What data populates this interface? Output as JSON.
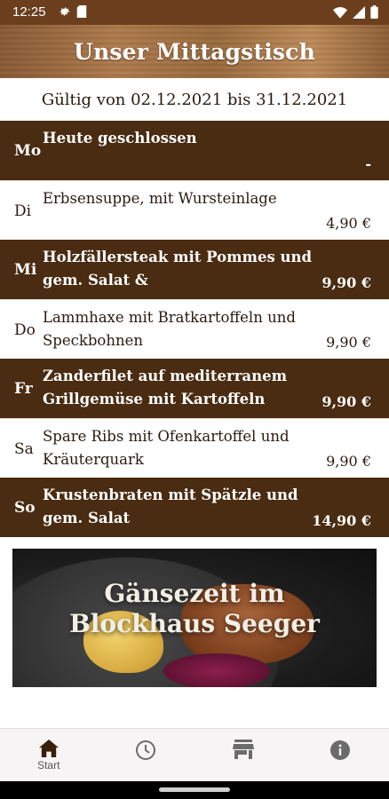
{
  "status_bar": {
    "time": "12:25",
    "icons": [
      "settings-icon",
      "sim-card-icon",
      "wifi-icon",
      "signal-icon",
      "battery-icon"
    ]
  },
  "header": {
    "title": "Unser Mittagstisch"
  },
  "validity": "Gültig von 02.12.2021 bis 31.12.2021",
  "menu": [
    {
      "day": "Mo",
      "dish": "Heute geschlossen",
      "price": "-",
      "style": "dark"
    },
    {
      "day": "Di",
      "dish": "Erbsensuppe, mit Wursteinlage",
      "price": "4,90 €",
      "style": "light"
    },
    {
      "day": "Mi",
      "dish": "Holzfällersteak mit Pommes und gem. Salat &",
      "price": "9,90 €",
      "style": "dark"
    },
    {
      "day": "Do",
      "dish": "Lammhaxe mit Bratkartoffeln und Speckbohnen",
      "price": "9,90 €",
      "style": "light"
    },
    {
      "day": "Fr",
      "dish": "Zanderfilet auf mediterranem Grillgemüse mit Kartoffeln",
      "price": "9,90 €",
      "style": "dark"
    },
    {
      "day": "Sa",
      "dish": "Spare Ribs mit Ofenkartoffel und Kräuterquark",
      "price": "9,90 €",
      "style": "light"
    },
    {
      "day": "So",
      "dish": "Krustenbraten mit Spätzle und gem. Salat",
      "price": "14,90 €",
      "style": "dark"
    }
  ],
  "banner": {
    "line1": "Gänsezeit im",
    "line2": "Blockhaus Seeger"
  },
  "bottom_nav": {
    "items": [
      {
        "icon": "home-icon",
        "label": "Start",
        "active": true
      },
      {
        "icon": "clock-icon",
        "label": "",
        "active": false
      },
      {
        "icon": "store-icon",
        "label": "",
        "active": false
      },
      {
        "icon": "info-icon",
        "label": "",
        "active": false
      }
    ]
  },
  "colors": {
    "status_bar": "#6b3f1d",
    "dark_row": "#4a2c12",
    "text_dark": "#2a1a10",
    "nav_background": "#f6f4f5"
  }
}
